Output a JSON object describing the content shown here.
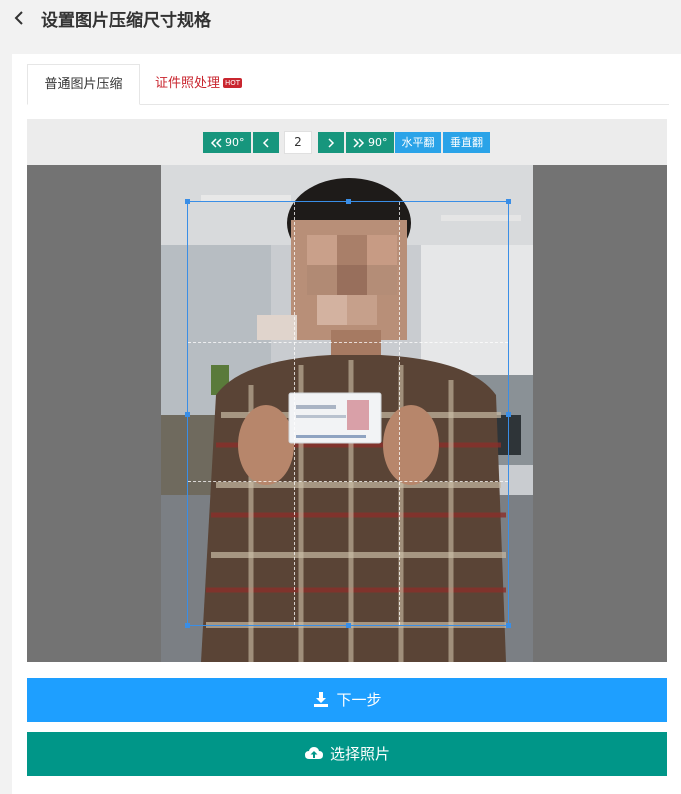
{
  "header": {
    "title": "设置图片压缩尺寸规格"
  },
  "tabs": [
    {
      "label": "普通图片压缩"
    },
    {
      "label": "证件照处理",
      "badge": "HOT"
    }
  ],
  "toolbar": {
    "rotate_left_label": "90°",
    "rotate_right_label": "90°",
    "page_number": "2",
    "flip_horizontal_label": "水平翻",
    "flip_vertical_label": "垂直翻"
  },
  "buttons": {
    "next_label": "下一步",
    "choose_label": "选择照片"
  },
  "colors": {
    "teal": "#17967d",
    "blue": "#2aa3e8",
    "primary": "#1e9fff",
    "green": "#009688",
    "hot_badge": "#c9262f"
  },
  "icons": [
    "back-icon",
    "double-chevron-left-icon",
    "chevron-left-icon",
    "chevron-right-icon",
    "double-chevron-right-icon",
    "download-icon",
    "cloud-upload-icon"
  ]
}
